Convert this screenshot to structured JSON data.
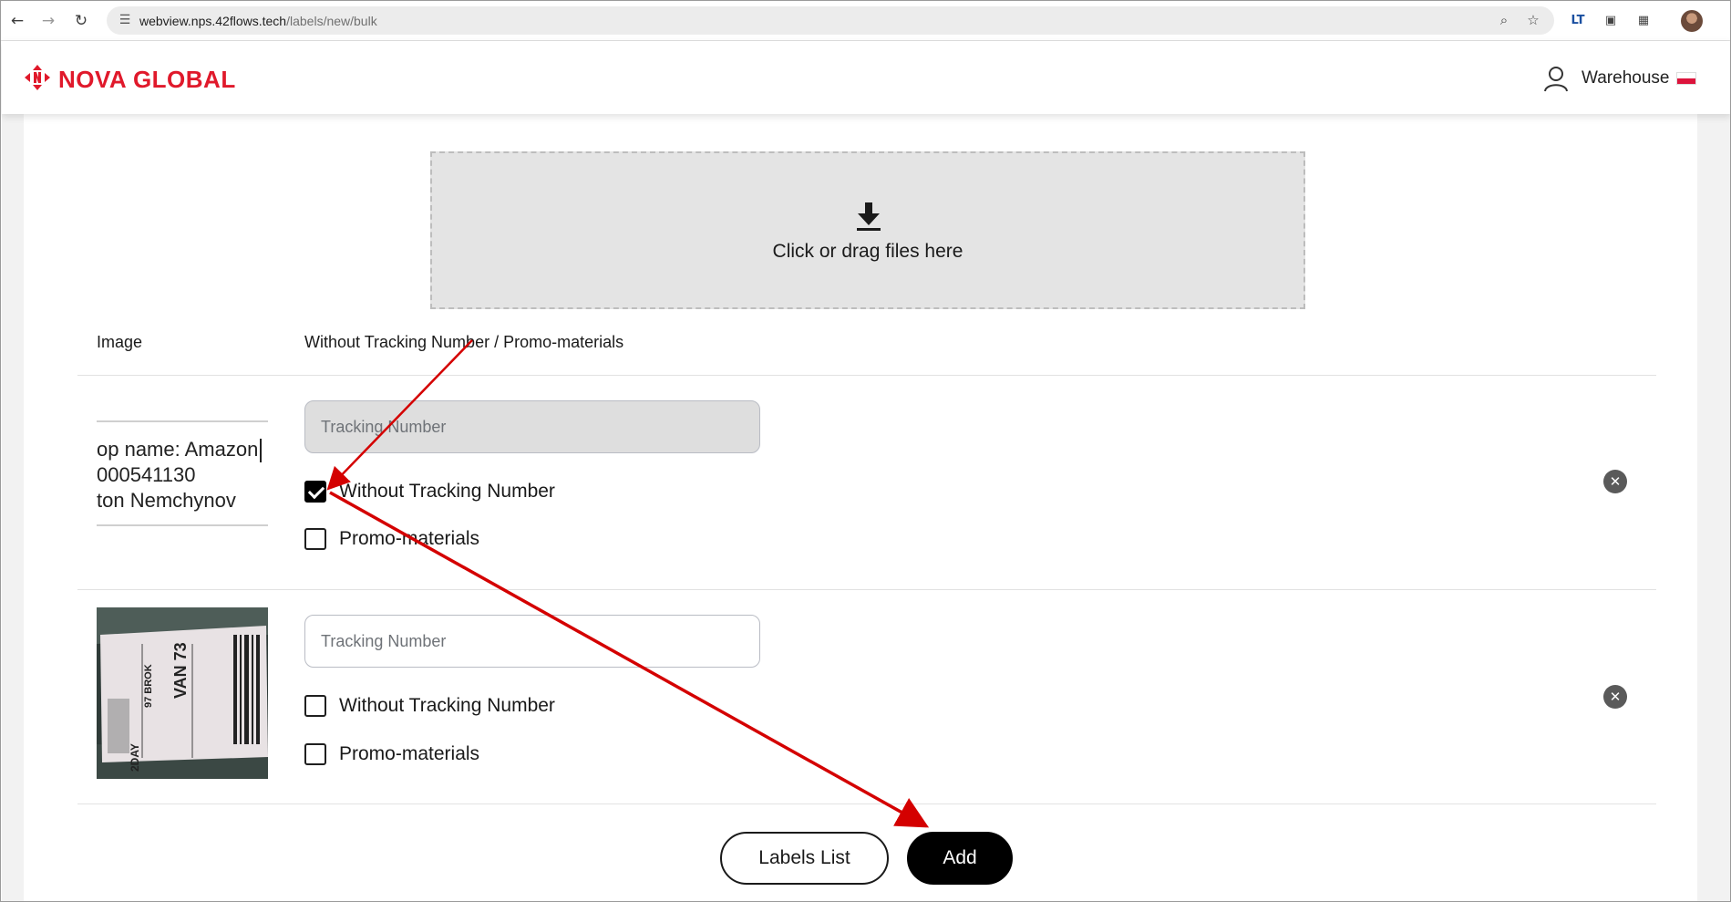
{
  "browser": {
    "url_host": "webview.nps.42flows.tech",
    "url_path": "/labels/new/bulk"
  },
  "header": {
    "brand": "NOVA GLOBAL",
    "user_label": "Warehouse",
    "accent": "#e0192b"
  },
  "upload": {
    "text": "Click or drag files here"
  },
  "table": {
    "col_image": "Image",
    "col_options": "Without Tracking Number / Promo-materials"
  },
  "rows": [
    {
      "image_lines": [
        "op name: Amazon",
        "000541130",
        "ton Nemchynov"
      ],
      "tracking_placeholder": "Tracking Number",
      "tracking_disabled": true,
      "without_tracking_label": "Without Tracking Number",
      "without_tracking_checked": true,
      "promo_label": "Promo-materials",
      "promo_checked": false
    },
    {
      "image_lines": [
        "97 BROK",
        "VAN 73",
        "2DAY"
      ],
      "tracking_placeholder": "Tracking Number",
      "tracking_disabled": false,
      "without_tracking_label": "Without Tracking Number",
      "without_tracking_checked": false,
      "promo_label": "Promo-materials",
      "promo_checked": false
    }
  ],
  "actions": {
    "labels_list": "Labels List",
    "add": "Add"
  },
  "annotation_color": "#d40000"
}
